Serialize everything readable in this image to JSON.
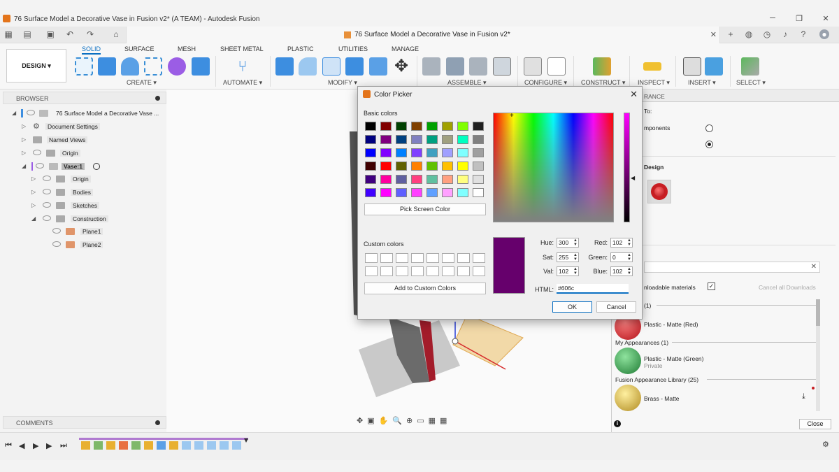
{
  "window": {
    "title": "76 Surface Model a Decorative Vase in Fusion v2* (A TEAM) - Autodesk Fusion",
    "document_tab": "76 Surface Model a Decorative Vase in Fusion v2*"
  },
  "ribbon": {
    "workspace": "DESIGN ▾",
    "tabs": [
      "SOLID",
      "SURFACE",
      "MESH",
      "SHEET METAL",
      "PLASTIC",
      "UTILITIES",
      "MANAGE"
    ],
    "active_tab": "SOLID",
    "groups": [
      "CREATE ▾",
      "AUTOMATE ▾",
      "MODIFY ▾",
      "ASSEMBLE ▾",
      "CONFIGURE ▾",
      "CONSTRUCT ▾",
      "INSPECT ▾",
      "INSERT ▾",
      "SELECT ▾"
    ]
  },
  "browser": {
    "header": "BROWSER",
    "items": [
      {
        "label": "76 Surface Model a Decorative Vase ..."
      },
      {
        "label": "Document Settings"
      },
      {
        "label": "Named Views"
      },
      {
        "label": "Origin"
      },
      {
        "label": "Vase:1"
      },
      {
        "label": "Origin"
      },
      {
        "label": "Bodies"
      },
      {
        "label": "Sketches"
      },
      {
        "label": "Construction"
      },
      {
        "label": "Plane1"
      },
      {
        "label": "Plane2"
      }
    ]
  },
  "comments": {
    "header": "COMMENTS"
  },
  "appearance_panel": {
    "header_fragment": "RANCE",
    "to_label": "To:",
    "components_label": "mponents",
    "in_design": "Design",
    "downloadable": "nloadable materials",
    "cancel_downloads": "Cancel all Downloads",
    "count_fragment": "(1)",
    "materials": [
      {
        "name": "Plastic - Matte (Red)",
        "sub": "",
        "color": "#c81e23"
      },
      {
        "name": "Plastic - Matte (Green)",
        "sub": "Private",
        "color": "#2fa24a"
      },
      {
        "name": "Brass - Matte",
        "sub": "",
        "color": "#d8b74a"
      }
    ],
    "sections": [
      "My Appearances (1)",
      "Fusion Appearance Library (25)"
    ],
    "close_label": "Close"
  },
  "color_picker": {
    "title": "Color Picker",
    "basic_colors_label": "Basic colors",
    "basic_colors": [
      "#000000",
      "#800000",
      "#004000",
      "#804000",
      "#00a000",
      "#a0a000",
      "#80ff00",
      "#202020",
      "#000080",
      "#800080",
      "#004080",
      "#8080c0",
      "#00a080",
      "#a0a080",
      "#00ffc0",
      "#808080",
      "#0000ff",
      "#8000ff",
      "#0080ff",
      "#8040ff",
      "#40a0c0",
      "#a0a0ff",
      "#80ffff",
      "#a0a0a0",
      "#400000",
      "#ff0000",
      "#606000",
      "#ff8000",
      "#60c000",
      "#ffc000",
      "#ffff00",
      "#c0c0c0",
      "#400080",
      "#ff00a0",
      "#6060a0",
      "#ff4080",
      "#60c0a0",
      "#ffa080",
      "#ffff80",
      "#e0e0e0",
      "#4000ff",
      "#ff00ff",
      "#6060ff",
      "#ff40ff",
      "#60a0ff",
      "#ffa0ff",
      "#80ffff",
      "#ffffff"
    ],
    "pick_screen_label": "Pick Screen Color",
    "custom_colors_label": "Custom colors",
    "add_custom_label": "Add to Custom Colors",
    "current_color": "#66006c",
    "hue_label": "Hue:",
    "hue": "300",
    "sat_label": "Sat:",
    "sat": "255",
    "val_label": "Val:",
    "val": "102",
    "red_label": "Red:",
    "red": "102",
    "green_label": "Green:",
    "green": "0",
    "blue_label": "Blue:",
    "blue": "102",
    "html_label": "HTML:",
    "html": "#606c",
    "ok_label": "OK",
    "cancel_label": "Cancel"
  },
  "accent_color": "#0a6fc2"
}
